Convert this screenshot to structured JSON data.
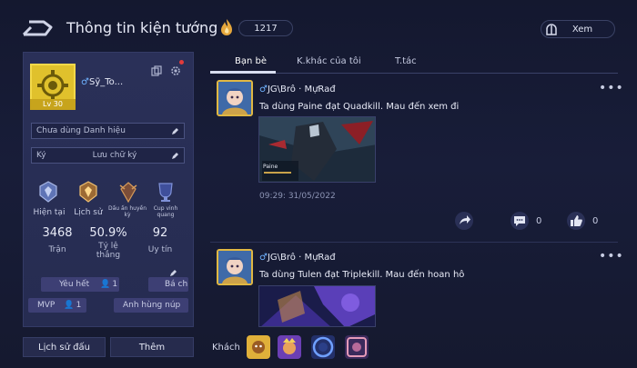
{
  "header": {
    "title": "Thông tin kiện tướng",
    "currency_value": "1217",
    "view_label": "Xem"
  },
  "profile": {
    "name": "Sỹ_To...",
    "level": "Lv 30",
    "title_field": "Chưa dùng Danh hiệu",
    "signature_label": "Ký",
    "signature_action": "Lưu chữ ký",
    "ranks": [
      {
        "label": "Hiện tại",
        "icon": "rank-current-icon"
      },
      {
        "label": "Lịch sử",
        "icon": "rank-history-icon"
      },
      {
        "label": "Dấu ấn huyền kỳ",
        "icon": "legend-mark-icon"
      },
      {
        "label": "Cup vinh quang",
        "icon": "glory-cup-icon"
      }
    ],
    "stats": [
      {
        "value": "3468",
        "label": "Trận"
      },
      {
        "value": "50.9%",
        "label": "Tỷ lệ thắng"
      },
      {
        "value": "92",
        "label": "Uy tín"
      }
    ],
    "tags": [
      {
        "label": "Yêu hết",
        "count": "1"
      },
      {
        "label": "Bá ch"
      },
      {
        "label": "MVP",
        "count": "1"
      },
      {
        "label": "Anh hùng núp"
      }
    ],
    "history_button": "Lịch sử đấu",
    "more_button": "Thêm"
  },
  "tabs": [
    {
      "label": "Bạn bè",
      "active": true
    },
    {
      "label": "K.khác của tôi",
      "active": false
    },
    {
      "label": "T.tác",
      "active": false
    }
  ],
  "posts": [
    {
      "author": "JG\\Brô · MựRađ",
      "text": "Ta dùng Paine đạt Quadkill. Mau đến xem đi",
      "time": "09:29: 31/05/2022",
      "comments": "0",
      "likes": "0",
      "image_caption": "Paine"
    },
    {
      "author": "JG\\Brô · MựRađ",
      "text": "Ta dùng Tulen đạt Triplekill. Mau đến hoan hô"
    }
  ],
  "guests": {
    "label": "Khách"
  },
  "colors": {
    "accent_gold": "#e1b843",
    "male_symbol": "#6fb2ff",
    "panel_bg": "#2a3058"
  }
}
